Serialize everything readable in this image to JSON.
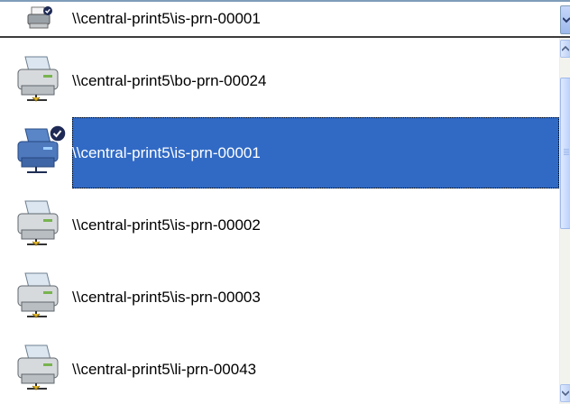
{
  "combo": {
    "selected_value": "\\\\central-print5\\is-prn-00001",
    "selected_icon": "default-printer-icon"
  },
  "printers": [
    {
      "path": "\\\\central-print5\\bo-prn-00024",
      "icon": "network-printer-icon",
      "selected": false,
      "default": false
    },
    {
      "path": "\\\\central-print5\\is-prn-00001",
      "icon": "default-printer-icon",
      "selected": true,
      "default": true
    },
    {
      "path": "\\\\central-print5\\is-prn-00002",
      "icon": "network-printer-icon",
      "selected": false,
      "default": false
    },
    {
      "path": "\\\\central-print5\\is-prn-00003",
      "icon": "network-printer-icon",
      "selected": false,
      "default": false
    },
    {
      "path": "\\\\central-print5\\li-prn-00043",
      "icon": "network-printer-icon",
      "selected": false,
      "default": false
    }
  ],
  "colors": {
    "selection": "#316ac5",
    "scrollbar": "#bcd0f6"
  }
}
